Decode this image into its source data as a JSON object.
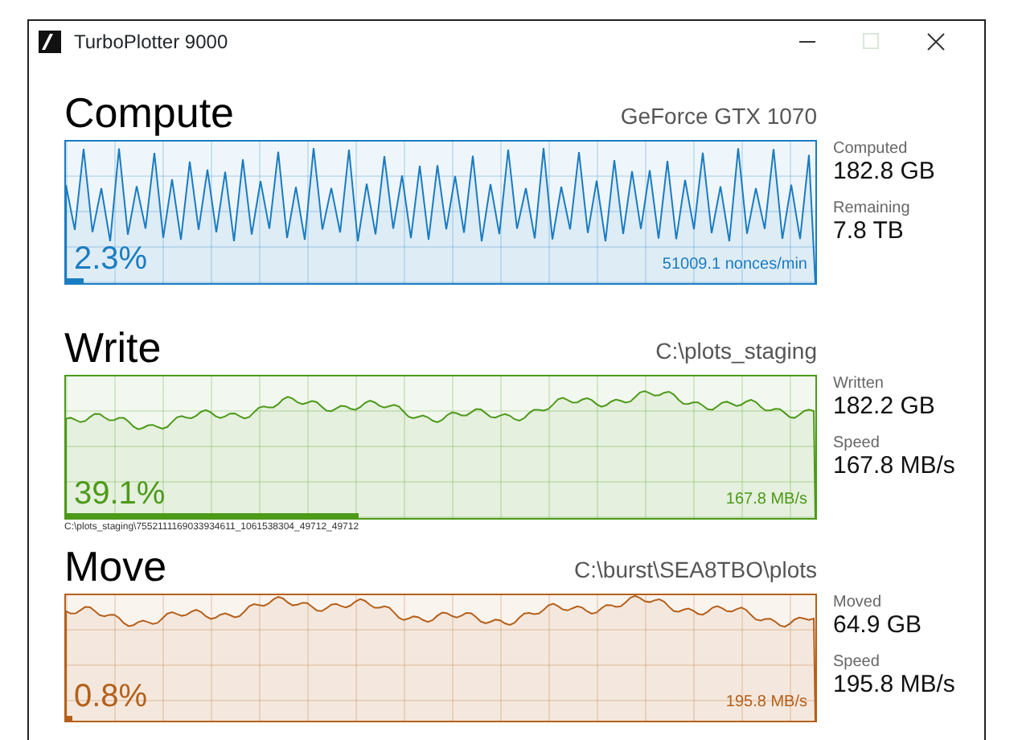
{
  "window": {
    "title": "TurboPlotter 9000"
  },
  "sections": [
    {
      "title": "Compute",
      "subtitle": "GeForce GTX 1070",
      "kind": "oscillation",
      "color": "#1a7cc1",
      "percent": "2.3%",
      "level": 0.023,
      "rate": "51009.1 nonces/min",
      "stats": [
        {
          "label": "Computed",
          "value": "182.8 GB"
        },
        {
          "label": "Remaining",
          "value": "7.8 TB"
        }
      ]
    },
    {
      "title": "Write",
      "subtitle": "C:\\plots_staging",
      "kind": "trace",
      "color": "#4c9a18",
      "percent": "39.1%",
      "level": 0.391,
      "rate": "167.8 MB/s",
      "path": "C:\\plots_staging\\7552111169033934611_1061538304_49712_49712",
      "stats": [
        {
          "label": "Written",
          "value": "182.2 GB"
        },
        {
          "label": "Speed",
          "value": "167.8 MB/s"
        }
      ]
    },
    {
      "title": "Move",
      "subtitle": "C:\\burst\\SEA8TBO\\plots",
      "kind": "trace",
      "color": "#b5601a",
      "percent": "0.8%",
      "level": 0.008,
      "rate": "195.8 MB/s",
      "stats": [
        {
          "label": "Moved",
          "value": "64.9 GB"
        },
        {
          "label": "Speed",
          "value": "195.8 MB/s"
        }
      ]
    }
  ]
}
